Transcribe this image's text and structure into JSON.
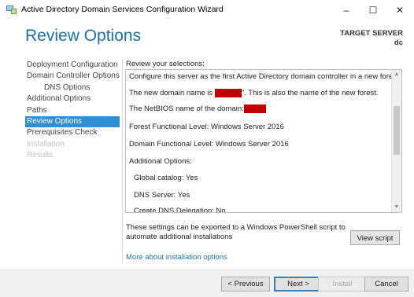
{
  "window": {
    "title": "Active Directory Domain Services Configuration Wizard",
    "minimize": "–",
    "maximize": "☐",
    "close": "✕"
  },
  "header": {
    "page_title": "Review Options",
    "target_label": "TARGET SERVER",
    "target_value": "dc"
  },
  "sidebar": {
    "items": [
      {
        "label": "Deployment Configuration",
        "state": "normal"
      },
      {
        "label": "Domain Controller Options",
        "state": "normal"
      },
      {
        "label": "DNS Options",
        "state": "normal"
      },
      {
        "label": "Additional Options",
        "state": "normal"
      },
      {
        "label": "Paths",
        "state": "normal"
      },
      {
        "label": "Review Options",
        "state": "active"
      },
      {
        "label": "Prerequisites Check",
        "state": "normal"
      },
      {
        "label": "Installation",
        "state": "disabled"
      },
      {
        "label": "Results",
        "state": "disabled"
      }
    ]
  },
  "main": {
    "review_label": "Review your selections:",
    "lines": {
      "l1": "Configure this server as the first Active Directory domain controller in a new forest.",
      "l2_before": "The new domain name is ",
      "l2_after": "\". This is also the name of the new forest.",
      "l3": "The NetBIOS name of the domain:",
      "l4": "Forest Functional Level: Windows Server 2016",
      "l5": "Domain Functional Level: Windows Server 2016",
      "l6": "Additional Options:",
      "l7": "Global catalog: Yes",
      "l8": "DNS Server: Yes",
      "l9": "Create DNS Delegation: No"
    },
    "export_text": "These settings can be exported to a Windows PowerShell script to automate additional installations",
    "view_script": "View script",
    "more_link": "More about installation options"
  },
  "footer": {
    "previous": "< Previous",
    "next": "Next >",
    "install": "Install",
    "cancel": "Cancel"
  },
  "colors": {
    "accent": "#2f8fd6",
    "title_blue": "#1f6fa8",
    "redaction": "#c00000"
  }
}
